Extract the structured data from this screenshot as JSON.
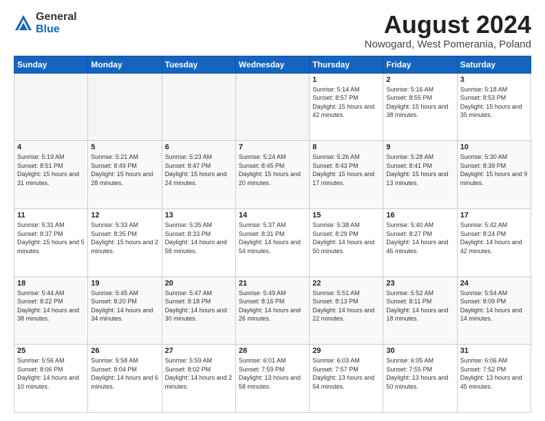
{
  "logo": {
    "general": "General",
    "blue": "Blue"
  },
  "header": {
    "title": "August 2024",
    "subtitle": "Nowogard, West Pomerania, Poland"
  },
  "weekdays": [
    "Sunday",
    "Monday",
    "Tuesday",
    "Wednesday",
    "Thursday",
    "Friday",
    "Saturday"
  ],
  "weeks": [
    [
      {
        "day": "",
        "info": ""
      },
      {
        "day": "",
        "info": ""
      },
      {
        "day": "",
        "info": ""
      },
      {
        "day": "",
        "info": ""
      },
      {
        "day": "1",
        "info": "Sunrise: 5:14 AM\nSunset: 8:57 PM\nDaylight: 15 hours\nand 42 minutes."
      },
      {
        "day": "2",
        "info": "Sunrise: 5:16 AM\nSunset: 8:55 PM\nDaylight: 15 hours\nand 38 minutes."
      },
      {
        "day": "3",
        "info": "Sunrise: 5:18 AM\nSunset: 8:53 PM\nDaylight: 15 hours\nand 35 minutes."
      }
    ],
    [
      {
        "day": "4",
        "info": "Sunrise: 5:19 AM\nSunset: 8:51 PM\nDaylight: 15 hours\nand 31 minutes."
      },
      {
        "day": "5",
        "info": "Sunrise: 5:21 AM\nSunset: 8:49 PM\nDaylight: 15 hours\nand 28 minutes."
      },
      {
        "day": "6",
        "info": "Sunrise: 5:23 AM\nSunset: 8:47 PM\nDaylight: 15 hours\nand 24 minutes."
      },
      {
        "day": "7",
        "info": "Sunrise: 5:24 AM\nSunset: 8:45 PM\nDaylight: 15 hours\nand 20 minutes."
      },
      {
        "day": "8",
        "info": "Sunrise: 5:26 AM\nSunset: 8:43 PM\nDaylight: 15 hours\nand 17 minutes."
      },
      {
        "day": "9",
        "info": "Sunrise: 5:28 AM\nSunset: 8:41 PM\nDaylight: 15 hours\nand 13 minutes."
      },
      {
        "day": "10",
        "info": "Sunrise: 5:30 AM\nSunset: 8:39 PM\nDaylight: 15 hours\nand 9 minutes."
      }
    ],
    [
      {
        "day": "11",
        "info": "Sunrise: 5:31 AM\nSunset: 8:37 PM\nDaylight: 15 hours\nand 5 minutes."
      },
      {
        "day": "12",
        "info": "Sunrise: 5:33 AM\nSunset: 8:35 PM\nDaylight: 15 hours\nand 2 minutes."
      },
      {
        "day": "13",
        "info": "Sunrise: 5:35 AM\nSunset: 8:33 PM\nDaylight: 14 hours\nand 58 minutes."
      },
      {
        "day": "14",
        "info": "Sunrise: 5:37 AM\nSunset: 8:31 PM\nDaylight: 14 hours\nand 54 minutes."
      },
      {
        "day": "15",
        "info": "Sunrise: 5:38 AM\nSunset: 8:29 PM\nDaylight: 14 hours\nand 50 minutes."
      },
      {
        "day": "16",
        "info": "Sunrise: 5:40 AM\nSunset: 8:27 PM\nDaylight: 14 hours\nand 46 minutes."
      },
      {
        "day": "17",
        "info": "Sunrise: 5:42 AM\nSunset: 8:24 PM\nDaylight: 14 hours\nand 42 minutes."
      }
    ],
    [
      {
        "day": "18",
        "info": "Sunrise: 5:44 AM\nSunset: 8:22 PM\nDaylight: 14 hours\nand 38 minutes."
      },
      {
        "day": "19",
        "info": "Sunrise: 5:45 AM\nSunset: 8:20 PM\nDaylight: 14 hours\nand 34 minutes."
      },
      {
        "day": "20",
        "info": "Sunrise: 5:47 AM\nSunset: 8:18 PM\nDaylight: 14 hours\nand 30 minutes."
      },
      {
        "day": "21",
        "info": "Sunrise: 5:49 AM\nSunset: 8:16 PM\nDaylight: 14 hours\nand 26 minutes."
      },
      {
        "day": "22",
        "info": "Sunrise: 5:51 AM\nSunset: 8:13 PM\nDaylight: 14 hours\nand 22 minutes."
      },
      {
        "day": "23",
        "info": "Sunrise: 5:52 AM\nSunset: 8:11 PM\nDaylight: 14 hours\nand 18 minutes."
      },
      {
        "day": "24",
        "info": "Sunrise: 5:54 AM\nSunset: 8:09 PM\nDaylight: 14 hours\nand 14 minutes."
      }
    ],
    [
      {
        "day": "25",
        "info": "Sunrise: 5:56 AM\nSunset: 8:06 PM\nDaylight: 14 hours\nand 10 minutes."
      },
      {
        "day": "26",
        "info": "Sunrise: 5:58 AM\nSunset: 8:04 PM\nDaylight: 14 hours\nand 6 minutes."
      },
      {
        "day": "27",
        "info": "Sunrise: 5:59 AM\nSunset: 8:02 PM\nDaylight: 14 hours\nand 2 minutes."
      },
      {
        "day": "28",
        "info": "Sunrise: 6:01 AM\nSunset: 7:59 PM\nDaylight: 13 hours\nand 58 minutes."
      },
      {
        "day": "29",
        "info": "Sunrise: 6:03 AM\nSunset: 7:57 PM\nDaylight: 13 hours\nand 54 minutes."
      },
      {
        "day": "30",
        "info": "Sunrise: 6:05 AM\nSunset: 7:55 PM\nDaylight: 13 hours\nand 50 minutes."
      },
      {
        "day": "31",
        "info": "Sunrise: 6:06 AM\nSunset: 7:52 PM\nDaylight: 13 hours\nand 45 minutes."
      }
    ]
  ]
}
